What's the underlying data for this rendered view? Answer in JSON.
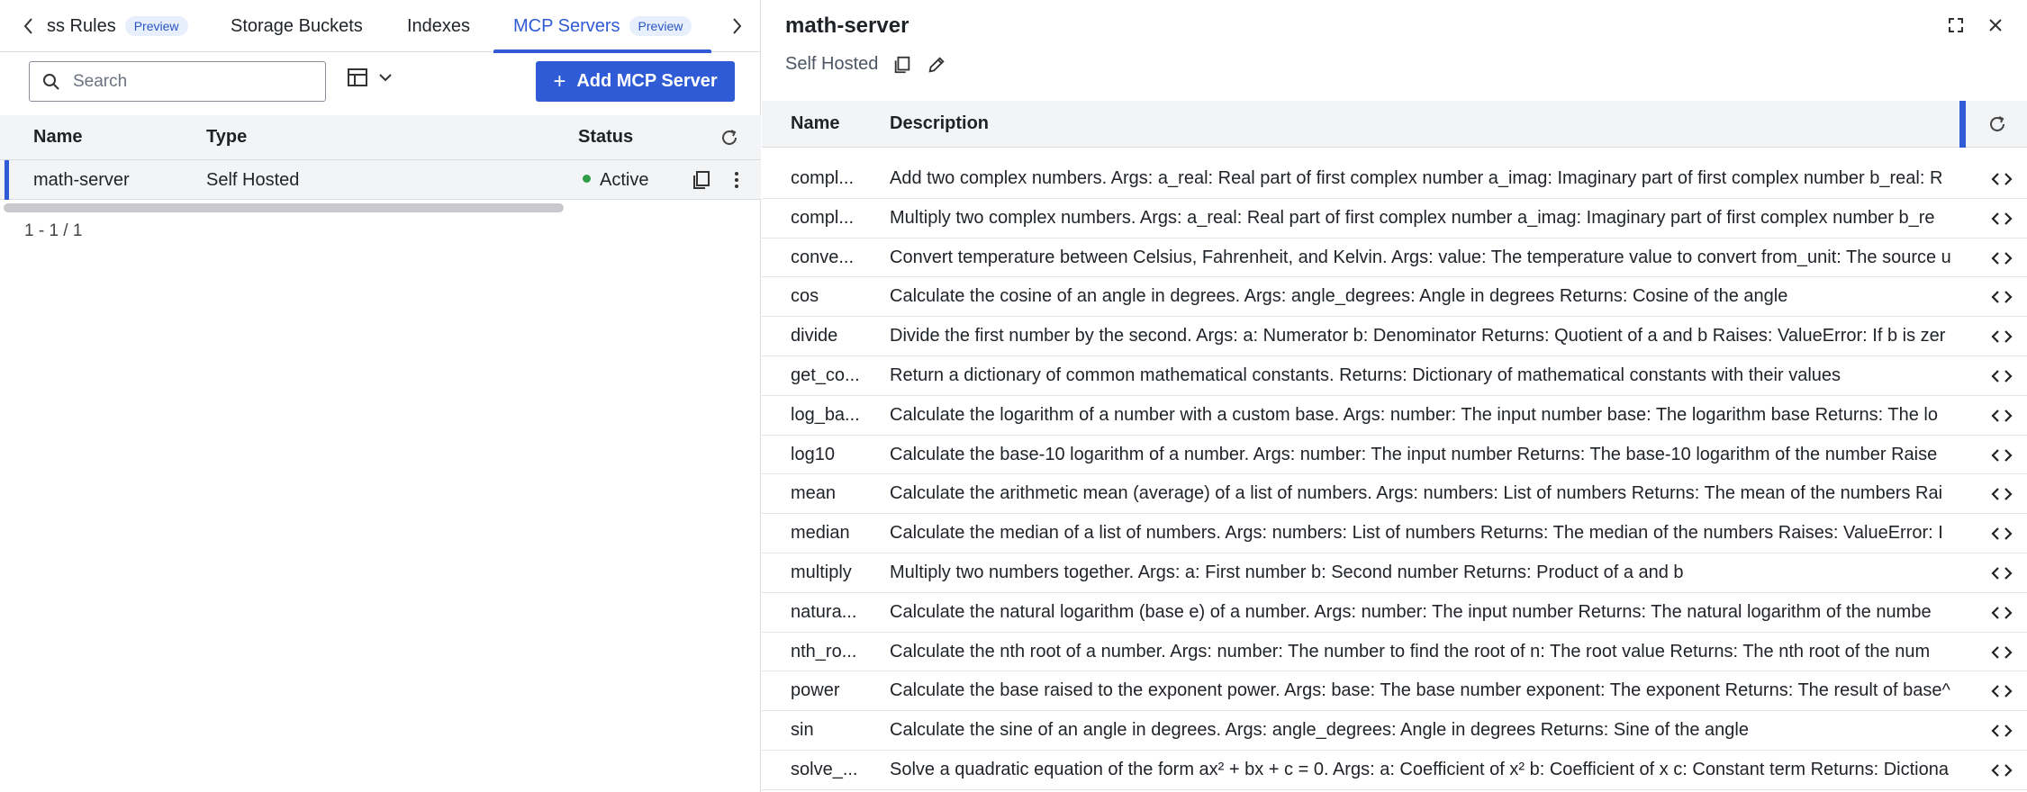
{
  "left": {
    "tabs": [
      {
        "label": "ss Rules",
        "badge": "Preview",
        "active": false
      },
      {
        "label": "Storage Buckets",
        "badge": "",
        "active": false
      },
      {
        "label": "Indexes",
        "badge": "",
        "active": false
      },
      {
        "label": "MCP Servers",
        "badge": "Preview",
        "active": true
      }
    ],
    "search": {
      "placeholder": "Search",
      "value": ""
    },
    "add_button": "Add MCP Server",
    "table": {
      "headers": {
        "name": "Name",
        "type": "Type",
        "status": "Status"
      },
      "rows": [
        {
          "name": "math-server",
          "type": "Self Hosted",
          "status": "Active"
        }
      ]
    },
    "pagination": "1 - 1 / 1",
    "colors": {
      "accent": "#2f5bd6",
      "status_active": "#2e9d48"
    }
  },
  "right": {
    "title": "math-server",
    "subtitle": "Self Hosted",
    "table": {
      "headers": {
        "name": "Name",
        "description": "Description"
      },
      "rows": [
        {
          "name": "compl...",
          "description": "Add two complex numbers. Args: a_real: Real part of first complex number a_imag: Imaginary part of first complex number b_real: R"
        },
        {
          "name": "compl...",
          "description": "Multiply two complex numbers. Args: a_real: Real part of first complex number a_imag: Imaginary part of first complex number b_re"
        },
        {
          "name": "conve...",
          "description": "Convert temperature between Celsius, Fahrenheit, and Kelvin. Args: value: The temperature value to convert from_unit: The source u"
        },
        {
          "name": "cos",
          "description": "Calculate the cosine of an angle in degrees. Args: angle_degrees: Angle in degrees Returns: Cosine of the angle"
        },
        {
          "name": "divide",
          "description": "Divide the first number by the second. Args: a: Numerator b: Denominator Returns: Quotient of a and b Raises: ValueError: If b is zer"
        },
        {
          "name": "get_co...",
          "description": "Return a dictionary of common mathematical constants. Returns: Dictionary of mathematical constants with their values"
        },
        {
          "name": "log_ba...",
          "description": "Calculate the logarithm of a number with a custom base. Args: number: The input number base: The logarithm base Returns: The lo"
        },
        {
          "name": "log10",
          "description": "Calculate the base-10 logarithm of a number. Args: number: The input number Returns: The base-10 logarithm of the number Raise"
        },
        {
          "name": "mean",
          "description": "Calculate the arithmetic mean (average) of a list of numbers. Args: numbers: List of numbers Returns: The mean of the numbers Rai"
        },
        {
          "name": "median",
          "description": "Calculate the median of a list of numbers. Args: numbers: List of numbers Returns: The median of the numbers Raises: ValueError: I"
        },
        {
          "name": "multiply",
          "description": "Multiply two numbers together. Args: a: First number b: Second number Returns: Product of a and b"
        },
        {
          "name": "natura...",
          "description": "Calculate the natural logarithm (base e) of a number. Args: number: The input number Returns: The natural logarithm of the numbe"
        },
        {
          "name": "nth_ro...",
          "description": "Calculate the nth root of a number. Args: number: The number to find the root of n: The root value Returns: The nth root of the num"
        },
        {
          "name": "power",
          "description": "Calculate the base raised to the exponent power. Args: base: The base number exponent: The exponent Returns: The result of base^"
        },
        {
          "name": "sin",
          "description": "Calculate the sine of an angle in degrees. Args: angle_degrees: Angle in degrees Returns: Sine of the angle"
        },
        {
          "name": "solve_...",
          "description": "Solve a quadratic equation of the form ax² + bx + c = 0. Args: a: Coefficient of x² b: Coefficient of x c: Constant term Returns: Dictiona"
        }
      ]
    }
  }
}
